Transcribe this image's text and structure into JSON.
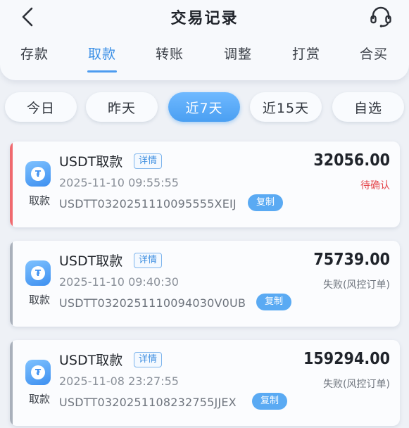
{
  "header": {
    "title": "交易记录"
  },
  "tabs": [
    {
      "label": "存款"
    },
    {
      "label": "取款"
    },
    {
      "label": "转账"
    },
    {
      "label": "调整"
    },
    {
      "label": "打赏"
    },
    {
      "label": "合买"
    }
  ],
  "active_tab": "取款",
  "filters": [
    {
      "label": "今日"
    },
    {
      "label": "昨天"
    },
    {
      "label": "近7天"
    },
    {
      "label": "近15天"
    },
    {
      "label": "自选"
    }
  ],
  "active_filter": "近7天",
  "records": [
    {
      "title": "USDT取款",
      "detail_label": "详情",
      "type_label": "取款",
      "time": "2025-11-10 09:55:55",
      "order_no": "USDTT0320251110095555XEIJ",
      "copy_label": "复制",
      "amount": "32056.00",
      "status": "待确认",
      "status_color": "#e5484d",
      "accent_color": "#f06a6f"
    },
    {
      "title": "USDT取款",
      "detail_label": "详情",
      "type_label": "取款",
      "time": "2025-11-10 09:40:30",
      "order_no": "USDTT0320251110094030V0UB",
      "copy_label": "复制",
      "amount": "75739.00",
      "status": "失败(风控订单)",
      "status_color": "#6e747d",
      "accent_color": "#a9b0bb"
    },
    {
      "title": "USDT取款",
      "detail_label": "详情",
      "type_label": "取款",
      "time": "2025-11-08 23:27:55",
      "order_no": "USDTT0320251108232755JJEX",
      "copy_label": "复制",
      "amount": "159294.00",
      "status": "失败(风控订单)",
      "status_color": "#6e747d",
      "accent_color": "#a9b0bb"
    }
  ]
}
